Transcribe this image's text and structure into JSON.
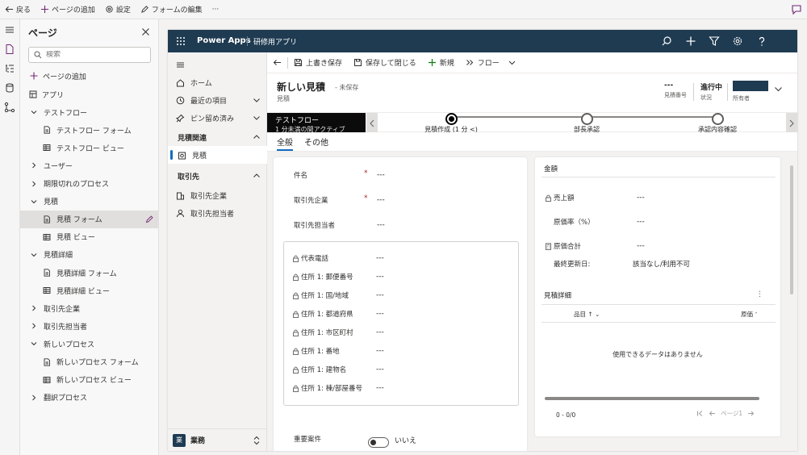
{
  "topbar": {
    "back": "戻る",
    "add_page": "ページの追加",
    "settings": "設定",
    "edit_form": "フォームの編集",
    "more": "···"
  },
  "pages_panel": {
    "title": "ページ",
    "search_placeholder": "検索",
    "add_page": "ページの追加",
    "items": [
      {
        "label": "アプリ",
        "type": "app"
      },
      {
        "label": "テストフロー",
        "type": "group"
      },
      {
        "label": "テストフロー フォーム",
        "type": "form"
      },
      {
        "label": "テストフロー ビュー",
        "type": "view"
      },
      {
        "label": "ユーザー",
        "type": "group"
      },
      {
        "label": "期限切れのプロセス",
        "type": "group"
      },
      {
        "label": "見積",
        "type": "group"
      },
      {
        "label": "見積 フォーム",
        "type": "form",
        "selected": true
      },
      {
        "label": "見積 ビュー",
        "type": "view"
      },
      {
        "label": "見積詳細",
        "type": "group"
      },
      {
        "label": "見積詳細 フォーム",
        "type": "form"
      },
      {
        "label": "見積詳細 ビュー",
        "type": "view"
      },
      {
        "label": "取引先企業",
        "type": "group"
      },
      {
        "label": "取引先担当者",
        "type": "group"
      },
      {
        "label": "新しいプロセス",
        "type": "group"
      },
      {
        "label": "新しいプロセス フォーム",
        "type": "form"
      },
      {
        "label": "新しいプロセス ビュー",
        "type": "view"
      },
      {
        "label": "翻訳プロセス",
        "type": "group"
      }
    ]
  },
  "app": {
    "brand": "Power Apps",
    "name": "研修用アプリ",
    "accent": "#1f3b52"
  },
  "sitemap": {
    "home": "ホーム",
    "recent": "最近の項目",
    "pinned": "ピン留め済み",
    "group1": "見積関連",
    "quote": "見積",
    "group2": "取引先",
    "accounts": "取引先企業",
    "contacts": "取引先担当者",
    "area_badge": "業",
    "area": "業務"
  },
  "commands": {
    "save": "上書き保存",
    "save_close": "保存して閉じる",
    "new": "新規",
    "flow": "フロー"
  },
  "header": {
    "title": "新しい見積",
    "status": "- 未保存",
    "entity": "見積",
    "quote_number_value": "---",
    "quote_number_label": "見積番号",
    "state_value": "進行中",
    "state_label": "状況",
    "owner_label": "所有者"
  },
  "bpf": {
    "name": "テストフロー",
    "duration": "1 分未満の間アクティブ",
    "stages": [
      {
        "label": "見積作成 (1 分 <)",
        "active": true
      },
      {
        "label": "部長承認",
        "active": false
      },
      {
        "label": "承認内容確認",
        "active": false
      }
    ]
  },
  "tabs": [
    "全般",
    "その他"
  ],
  "general": {
    "fields": [
      {
        "label": "件名",
        "required": true,
        "value": "---"
      },
      {
        "label": "取引先企業",
        "required": true,
        "value": "---"
      },
      {
        "label": "取引先担当者",
        "required": false,
        "value": "---"
      }
    ],
    "address": [
      {
        "label": "代表電話",
        "value": "---"
      },
      {
        "label": "住所 1: 郵便番号",
        "value": "---"
      },
      {
        "label": "住所 1: 国/地域",
        "value": "---"
      },
      {
        "label": "住所 1: 都道府県",
        "value": "---"
      },
      {
        "label": "住所 1: 市区町村",
        "value": "---"
      },
      {
        "label": "住所 1: 番地",
        "value": "---"
      },
      {
        "label": "住所 1: 建物名",
        "value": "---"
      },
      {
        "label": "住所 1: 棟/部屋番号",
        "value": "---"
      }
    ],
    "important_label": "重要案件",
    "important_value": "いいえ"
  },
  "amount": {
    "title": "金額",
    "fields": [
      {
        "label": "売上額",
        "value": "---",
        "icon": "lock"
      },
      {
        "label": "原価率（%）",
        "value": "---",
        "icon": ""
      },
      {
        "label": "原価合計",
        "value": "---",
        "icon": "calc"
      },
      {
        "label": "最終更新日:",
        "value": "該当なし/利用不可",
        "icon": ""
      }
    ]
  },
  "subgrid": {
    "title": "見積詳細",
    "col1": "品目 ↑",
    "col2": "原価",
    "empty": "使用できるデータはありません",
    "count": "0 - 0/0",
    "page": "ページ1"
  }
}
